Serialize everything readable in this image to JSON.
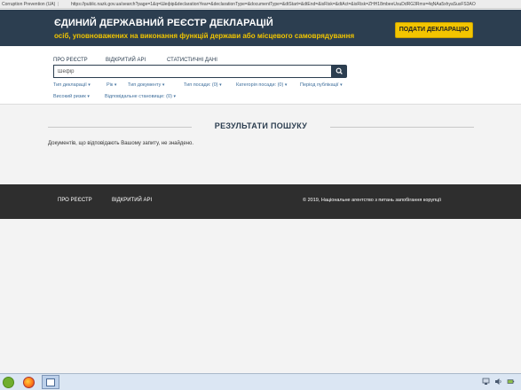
{
  "browser": {
    "tab_title": "Corruption Prevention (UA)",
    "url": "https://public.nazk.gov.ua/search?page=1&q=Шефір&declarationYear=&declarationType=&documentType=&dtStart=&dtEnd=&isRisk=&dtAct=&isRisk=ZHH18mbeeUsuDdRG3Rms=4qNAa5xhyaSusFS3AO"
  },
  "header": {
    "title": "ЄДИНИЙ ДЕРЖАВНИЙ РЕЄСТР ДЕКЛАРАЦІЙ",
    "subtitle": "осіб, уповноважених на виконання функцій держави або місцевого самоврядування",
    "submit_label": "ПОДАТИ ДЕКЛАРАЦІЮ"
  },
  "nav": {
    "about": "ПРО РЕЄСТР",
    "api": "ВІДКРИТИЙ API",
    "stats": "СТАТИСТИЧНІ ДАНІ"
  },
  "search": {
    "value": "Шефір"
  },
  "filters": {
    "row1": [
      {
        "label": "Тип декларації"
      },
      {
        "label": "Рік"
      },
      {
        "label": "Тип документу"
      },
      {
        "label": "Тип посади: (0)"
      },
      {
        "label": "Категорія посади: (0)"
      },
      {
        "label": "Період публікації"
      }
    ],
    "row2": [
      {
        "label": "Високий ризик"
      },
      {
        "label": "Відповідальне становище: (0)"
      }
    ]
  },
  "results": {
    "title": "РЕЗУЛЬТАТИ ПОШУКУ",
    "empty_message": "Документів, що відповідають Вашому запиту, не знайдено."
  },
  "footer": {
    "about": "ПРО РЕЄСТР",
    "api": "ВІДКРИТИЙ API",
    "copyright": "© 2019, Національне агентство з питань запобігання корупції"
  },
  "colors": {
    "header_bg": "#2c3e50",
    "subtitle": "#f0c400",
    "submit_bg": "#f3c500",
    "footer_bg": "#2e2e2e",
    "filter_link": "#3f6f9c"
  }
}
